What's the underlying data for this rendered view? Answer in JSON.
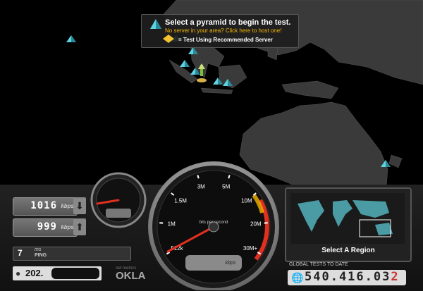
{
  "banner": {
    "title": "Select a pyramid to begin the test.",
    "host_link": "No server in your area? Click here to host one!",
    "recommended": "= Test Using Recommended Server"
  },
  "colors": {
    "accent_orange": "#f7b500",
    "needle_red": "#e03020",
    "land_gray": "#3a3a3a",
    "pyramid_cyan": "#5fd3e0"
  },
  "download": {
    "value": "1016",
    "unit": "kbps",
    "arrow": "down-arrow-icon"
  },
  "upload": {
    "value": "999",
    "unit": "kbps",
    "arrow": "up-arrow-icon"
  },
  "ping": {
    "value": "7",
    "unit": "ms",
    "label": "PING"
  },
  "ip": {
    "visible": "202."
  },
  "brand": {
    "small": "net metrics",
    "name": "OKLA"
  },
  "gauge": {
    "ticks": [
      "512k",
      "1M",
      "1.5M",
      "3M",
      "5M",
      "10M",
      "20M",
      "30M+"
    ],
    "tick_values": [
      0.5,
      1,
      1.5,
      3,
      5,
      10,
      20,
      30
    ],
    "unit_label": "bits per second",
    "readout_unit": "kbps",
    "needle_value": 0
  },
  "region": {
    "label": "Select A Region"
  },
  "counter": {
    "label": "GLOBAL TESTS TO DATE",
    "digits": "540.416.03",
    "last_digit": "2"
  }
}
